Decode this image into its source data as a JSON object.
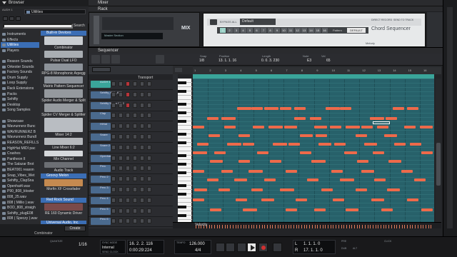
{
  "browser": {
    "title": "Browser",
    "search_label": "Search",
    "location": "Utilities",
    "device_small": "AUDH 1",
    "locations": [
      "Instruments",
      "Effects",
      "Utilities",
      "Players",
      "",
      "Reason Sounds",
      "Orkester Sounds",
      "Factory Sounds",
      "Drum Supply",
      "Loop Supply",
      "Rack Extensions",
      "Packs",
      "Sehifty",
      "Desktop",
      "Song Samples",
      "",
      "Showcase",
      "Wavrunnerz Bunc",
      "WAVRUNNERZ B",
      "Wavrunnerz Bundl",
      "REASON_REFILLS",
      "HighHat MIDI pac",
      "Crashes",
      "Pantheon II",
      "The Salazar Brot",
      "BEAT001 reason",
      "Snap_Vibes_Wet",
      "Sehifty_ClapSna",
      "Openhat4.wav",
      "P90_808_bloster",
      "808_25.wav",
      "808 ( Millio ).wav",
      "BOD_808_straigh",
      "Sehifty_plugE08",
      "808 ( Speczy ).wav"
    ],
    "selected_location": "Utilities",
    "sections": [
      {
        "head": "Built-in Devices"
      },
      {
        "head": "Groovy Melon"
      },
      {
        "head": "Red Rock Sound"
      },
      {
        "head": "Universal Audio, Inc."
      }
    ],
    "devices": [
      "Combinator",
      "Pulsar Dual LFO",
      "RPG-8 Monophonic Arpegg",
      "Matrix Pattern Sequencer",
      "Spider Audio Merger & Split",
      "Spider CV Merger & Splitter",
      "Mixer 14:2",
      "Line Mixer 6:2",
      "Mix Channel",
      "Audio Track",
      "Morfin XF Crossfader",
      "RE 160 Dynamic Driver"
    ],
    "create_label": "Create",
    "footer": "Combinator"
  },
  "mixer": {
    "title": "Mixer"
  },
  "rack": {
    "title": "Rack",
    "master_section": "Master Section",
    "mix_label": "MIX",
    "default_label": "Default",
    "bypass_label": "BYPASS ALL",
    "pattern_label": "Pattern",
    "pattern_value": "DEFAULT",
    "pads": [
      "1",
      "2",
      "3",
      "4",
      "5",
      "6",
      "7",
      "8",
      "9",
      "10",
      "11",
      "12",
      "13",
      "14",
      "15",
      "16"
    ],
    "direct_label": "DIRECT RECORD",
    "send_label": "SEND TO TRACK",
    "product_name": "Chord Sequencer",
    "melody_label": "Melody"
  },
  "sequencer": {
    "title": "Sequencer",
    "snap": "1/8",
    "snap_label": "Snap",
    "position_label": "Position",
    "position": "13. 1. 1. 16",
    "length_label": "Length",
    "length": "0. 0. 3. 230",
    "note_label": "Note",
    "note": "E3",
    "vel_label": "Vel",
    "vel": "65",
    "transport_lbl": "Transport",
    "ruler": [
      "1",
      "2",
      "3",
      "4",
      "5",
      "6",
      "7",
      "8",
      "9",
      "10",
      "11",
      "12",
      "13",
      "14",
      "15",
      "16"
    ],
    "clip_name": "Chord",
    "velocity_label": "Velocity",
    "tracks": [
      {
        "name": "AUDH 1",
        "color": "#3aa59a"
      },
      {
        "name": "Sehifty_P90_808",
        "color": "#4a6a8e"
      },
      {
        "name": "Sehifty Snare EX 2",
        "color": "#4a6a8e"
      },
      {
        "name": "Clap",
        "color": "#4a6a8e"
      },
      {
        "name": "HiHat",
        "color": "#4a6a8e"
      },
      {
        "name": "Snare",
        "color": "#4a6a8e"
      },
      {
        "name": "Snare 2",
        "color": "#4a6a8e"
      },
      {
        "name": "Openhat",
        "color": "#4a6a8e"
      },
      {
        "name": "Perc",
        "color": "#4a6a8e"
      },
      {
        "name": "Perc 2",
        "color": "#4a6a8e"
      },
      {
        "name": "Perc 3",
        "color": "#4a6a8e"
      },
      {
        "name": "Perc 4",
        "color": "#4a6a8e"
      },
      {
        "name": "Perc 5",
        "color": "#4a6a8e"
      },
      {
        "name": "Perc 6",
        "color": "#4a6a8e"
      }
    ]
  },
  "transport": {
    "sync_label": "SYNC MODE",
    "sync_value": "Internal",
    "send_clock": "SEND CLOCK",
    "quantize_label": "QUANTIZE",
    "quantize": "1/16",
    "position": "16. 2. 2. 116",
    "time": "0:00:29:224",
    "tempo_label": "TEMPO",
    "tempo": "126.000",
    "signature": "4/4",
    "loop_l_label": "L",
    "loop_l": "1. 1. 1. 0",
    "loop_r_label": "R",
    "loop_r": "17. 1. 1. 0",
    "pre_label": "PRE",
    "dub_label": "DUB",
    "alt_label": "ALT",
    "click_label": "CLICK"
  },
  "colors": {
    "note": "#ee6a4a",
    "roll_bg": "#27616a",
    "clip": "#3aa59a",
    "accent": "#3b6eb5"
  }
}
